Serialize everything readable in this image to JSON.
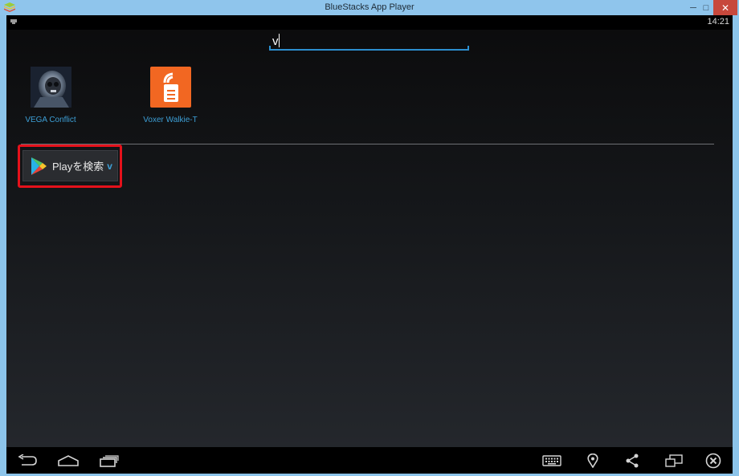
{
  "window": {
    "title": "BlueStacks App Player",
    "minimize_glyph": "─",
    "maximize_glyph": "□",
    "close_glyph": "✕",
    "accent_color": "#8fc5ec",
    "close_color": "#c7483c"
  },
  "status_bar": {
    "time": "14:21",
    "left_icon": "notification-icon"
  },
  "search": {
    "value": "v",
    "underline_color": "#2c8fcf"
  },
  "results": {
    "apps": [
      {
        "label": "VEGA Conflict",
        "icon": "vega-conflict-app-icon"
      },
      {
        "label": "Voxer Walkie-T",
        "icon": "voxer-walkie-talkie-app-icon"
      }
    ],
    "label_color": "#3d9fd6"
  },
  "play_search": {
    "label": "Playを検索",
    "query": "v",
    "icon": "google-play-icon",
    "highlight_color": "#e5111b"
  },
  "nav_bar": {
    "buttons": [
      "back-icon",
      "home-icon",
      "recent-apps-icon",
      "keyboard-icon",
      "location-icon",
      "share-icon",
      "screen-resize-icon",
      "close-circle-icon"
    ]
  }
}
